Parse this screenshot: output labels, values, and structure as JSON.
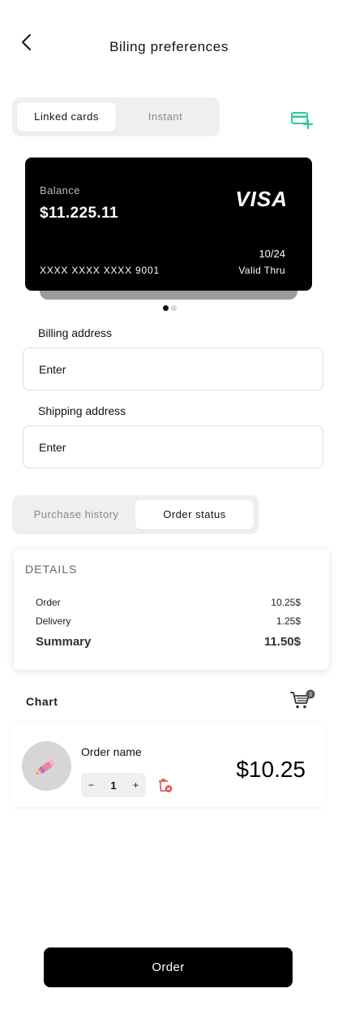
{
  "header": {
    "title": "Biling preferences",
    "back_icon": "chevron-left-icon"
  },
  "card_tabs": {
    "items": [
      {
        "label": "Linked cards",
        "active": true
      },
      {
        "label": "Instant",
        "active": false
      }
    ],
    "add_card_icon": "credit-card-plus-icon",
    "accent_color": "#2ecc8f"
  },
  "card": {
    "balance_label": "Balance",
    "balance": "$11.225.11",
    "brand": "VISA",
    "number": "XXXX XXXX XXXX 9001",
    "expiry": "10/24",
    "valid_label": "Valid Thru"
  },
  "carousel": {
    "count": 2,
    "active_index": 0
  },
  "billing": {
    "label": "Billing address",
    "placeholder": "Enter"
  },
  "shipping": {
    "label": "Shipping address",
    "placeholder": "Enter"
  },
  "order_tabs": {
    "items": [
      {
        "label": "Purchase history",
        "active": false
      },
      {
        "label": "Order status",
        "active": true
      }
    ]
  },
  "details": {
    "title": "DETAILS",
    "rows": [
      {
        "label": "Order",
        "value": "10.25$"
      },
      {
        "label": "Delivery",
        "value": "1.25$"
      }
    ],
    "summary": {
      "label": "Summary",
      "value": "11.50$"
    }
  },
  "chart": {
    "title": "Chart",
    "cart_icon": "shopping-cart-icon",
    "cart_count": "3",
    "item": {
      "name": "Order name",
      "quantity": "1",
      "minus": "−",
      "plus": "+",
      "price": "$10.25",
      "image_icon": "pencil-icon",
      "delete_icon": "trash-icon",
      "delete_color": "#e04545"
    }
  },
  "footer": {
    "order_label": "Order"
  }
}
